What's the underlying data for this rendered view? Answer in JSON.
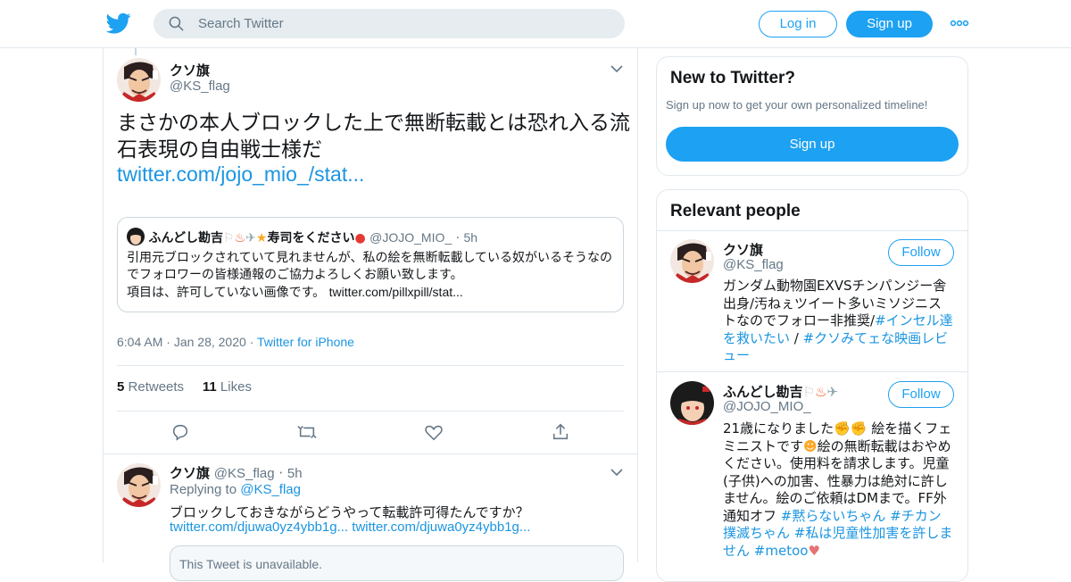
{
  "header": {
    "search_placeholder": "Search Twitter",
    "login_label": "Log in",
    "signup_label": "Sign up"
  },
  "tweet": {
    "author_name": "クソ旗",
    "author_handle": "@KS_flag",
    "text": "まさかの本人ブロックした上で無断転載とは恐れ入る流石表現の自由戦士様だ",
    "link": "twitter.com/jojo_mio_/stat...",
    "quote": {
      "author_name": "ふんどし勘吉",
      "author_name_suffix": "寿司をください",
      "author_handle": "@JOJO_MIO_",
      "time": "5h",
      "text_line1": "引用元ブロックされていて見れませんが、私の絵を無断転載している奴がいるそうなのでフォロワーの皆様通報のご協力よろしくお願い致します。",
      "text_line2": "項目は、許可していない画像です。",
      "link": "twitter.com/pillxpill/stat..."
    },
    "time": "6:04 AM",
    "date": "Jan 28, 2020",
    "source": "Twitter for iPhone",
    "retweets_count": "5",
    "retweets_label": "Retweets",
    "likes_count": "11",
    "likes_label": "Likes"
  },
  "reply": {
    "author_name": "クソ旗",
    "author_handle": "@KS_flag",
    "time": "5h",
    "replying_label": "Replying to",
    "replying_handle": "@KS_flag",
    "text": "ブロックしておきながらどうやって転載許可得たんですか？",
    "link1": "twitter.com/djuwa0yz4ybb1g...",
    "link2": "twitter.com/djuwa0yz4ybb1g...",
    "unavailable": "This Tweet is unavailable."
  },
  "sidebar": {
    "new_title": "New to Twitter?",
    "new_subtitle": "Sign up now to get your own personalized timeline!",
    "signup_label": "Sign up",
    "relevant_title": "Relevant people",
    "people": [
      {
        "name": "クソ旗",
        "handle": "@KS_flag",
        "follow_label": "Follow",
        "bio_text": "ガンダム動物園EXVSチンパンジー舎出身/汚ねぇツイート多いミソジニストなのでフォロー非推奨/",
        "bio_tag1": "#インセル達を救いたい",
        "bio_sep": " / ",
        "bio_tag2": "#クソみてェな映画レビュー"
      },
      {
        "name": "ふんどし勘吉",
        "handle": "@JOJO_MIO_",
        "follow_label": "Follow",
        "bio_text1": "21歳になりました",
        "bio_text2": " 絵を描くフェミニストです",
        "bio_text3": "絵の無断転載はおやめください。使用料を請求します。児童(子供)への加害、性暴力は絶対に許しません。絵のご依頼はDMまで。FF外通知オフ ",
        "bio_tag1": "#黙らないちゃん",
        "bio_tag2": "#チカン撲滅ちゃん",
        "bio_tag3": "#私は児童性加害を許しません",
        "bio_tag4": "#metoo"
      }
    ]
  },
  "colors": {
    "brand": "#1da1f2",
    "link": "#1b95e0",
    "muted": "#657786",
    "border": "#e1e8ed"
  }
}
